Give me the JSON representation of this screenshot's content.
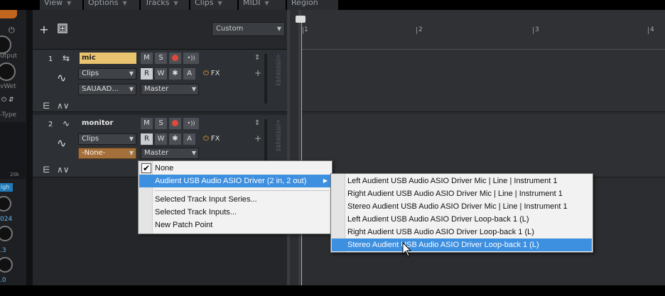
{
  "menubar": {
    "items": [
      {
        "label": "View"
      },
      {
        "label": "Options"
      },
      {
        "label": "Tracks"
      },
      {
        "label": "Clips"
      },
      {
        "label": "MIDI"
      },
      {
        "label": "Region FX"
      }
    ]
  },
  "left_panel": {
    "texts": [
      "utput",
      "vWet",
      "-Type",
      "20k",
      "igh",
      "024",
      ".3",
      ".0"
    ]
  },
  "toolbar": {
    "add_track_symbol": "+",
    "view_preset": "Custom"
  },
  "timeline": {
    "markers": [
      "1",
      "2",
      "3",
      "4"
    ]
  },
  "tracks": [
    {
      "number": "1",
      "name": "mic",
      "mute": "M",
      "solo": "S",
      "input_echo": "•))",
      "clips_label": "Clips",
      "read": "R",
      "write": "W",
      "star": "✱",
      "auto": "A",
      "fx": "FX",
      "input": "SAUAAD...",
      "output": "Master"
    },
    {
      "number": "2",
      "name": "monitor",
      "mute": "M",
      "solo": "S",
      "input_echo": "•))",
      "clips_label": "Clips",
      "read": "R",
      "write": "W",
      "star": "✱",
      "auto": "A",
      "fx": "FX",
      "input": "-None-",
      "output": "Master"
    }
  ],
  "input_menu": {
    "items": [
      {
        "label": "None",
        "checked": true
      },
      {
        "label": "Audient USB Audio ASIO Driver (2 in, 2 out)",
        "submenu": true
      },
      {
        "label": "Selected Track Input Series..."
      },
      {
        "label": "Selected Track Inputs..."
      },
      {
        "label": "New Patch Point"
      }
    ]
  },
  "driver_submenu": {
    "items": [
      {
        "label": "Left Audient USB Audio ASIO Driver Mic | Line | Instrument 1"
      },
      {
        "label": "Right Audient USB Audio ASIO Driver Mic | Line | Instrument 1"
      },
      {
        "label": "Stereo Audient USB Audio ASIO Driver Mic | Line | Instrument 1"
      },
      {
        "label": "Left Audient USB Audio ASIO Driver Loop-back 1 (L)"
      },
      {
        "label": "Right Audient USB Audio ASIO Driver Loop-back 1 (L)"
      },
      {
        "label": "Stereo Audient USB Audio ASIO Driver Loop-back 1 (L)",
        "highlighted": true
      }
    ]
  },
  "colors": {
    "accent_selected": "#3d8fe0",
    "track_name_highlight": "#e9c36f",
    "input_highlight": "#a36f3b",
    "record": "#e04a3a",
    "fx_power": "#f0a030"
  }
}
